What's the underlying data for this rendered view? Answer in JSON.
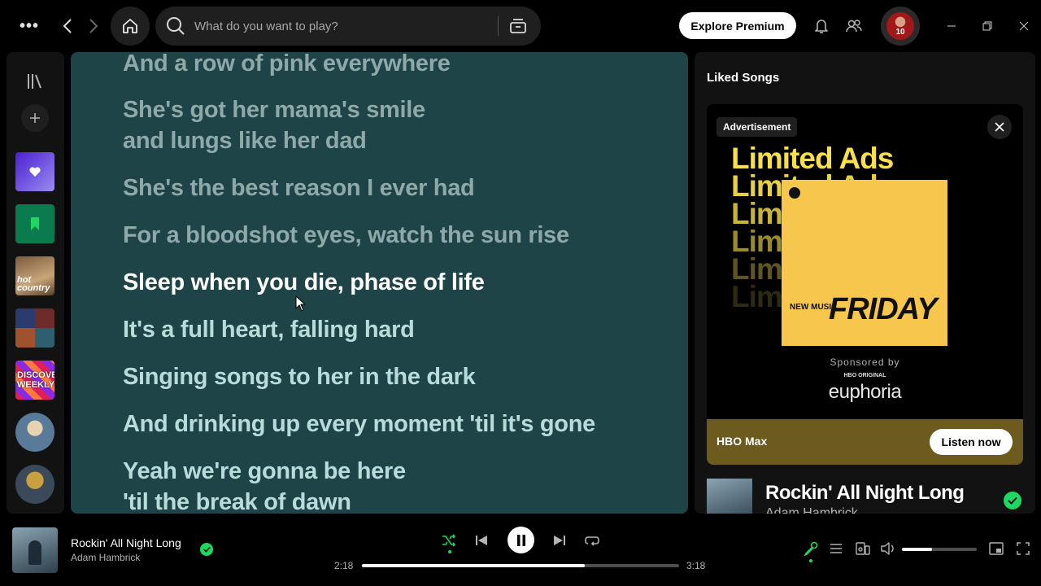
{
  "topbar": {
    "menu_icon": "more-dots-icon",
    "search_placeholder": "What do you want to play?",
    "premium_label": "Explore Premium",
    "avatar_label": "10"
  },
  "sidebar": {
    "items": [
      {
        "name": "Liked Songs"
      },
      {
        "name": "Your Episodes"
      },
      {
        "name": "Hot Country",
        "label": "hot country"
      },
      {
        "name": "Mix"
      },
      {
        "name": "Discover Weekly",
        "label": "DISCOVER WEEKLY"
      },
      {
        "name": "Artist 1"
      },
      {
        "name": "Artist 2"
      }
    ]
  },
  "lyrics": {
    "lines": [
      {
        "text": "And a row of pink everywhere",
        "state": "past"
      },
      {
        "text": "She's got her mama's smile",
        "state": "past"
      },
      {
        "text": "and lungs like her dad",
        "state": "past"
      },
      {
        "text": "She's the best reason I ever had",
        "state": "past"
      },
      {
        "text": "For a bloodshot eyes, watch the sun rise",
        "state": "past"
      },
      {
        "text": "Sleep when you die, phase of life",
        "state": "active"
      },
      {
        "text": "It's a full heart, falling hard",
        "state": "upcoming"
      },
      {
        "text": "Singing songs to her in the dark",
        "state": "upcoming"
      },
      {
        "text": "And drinking up every moment 'til it's gone",
        "state": "upcoming"
      },
      {
        "text": "Yeah we're gonna be here",
        "state": "upcoming"
      },
      {
        "text": "'til the break of dawn",
        "state": "upcoming"
      }
    ]
  },
  "right_panel": {
    "title": "Liked Songs",
    "ad": {
      "badge": "Advertisement",
      "headline": "Limited Ads",
      "cover_small": "NEW MUSIC",
      "cover_big": "FRIDAY",
      "sponsored_by": "Sponsored by",
      "sponsor_small": "HBO ORIGINAL",
      "sponsor_name": "euphoria",
      "advertiser": "HBO Max",
      "cta": "Listen now"
    },
    "now_playing": {
      "title": "Rockin' All Night Long",
      "artist": "Adam Hambrick"
    }
  },
  "player": {
    "title": "Rockin' All Night Long",
    "artist": "Adam Hambrick",
    "current_time": "2:18",
    "total_time": "3:18",
    "progress": 0.703,
    "volume": 0.4,
    "shuffle_on": true,
    "is_playing": true
  },
  "colors": {
    "accent": "#1ed760",
    "lyrics_bg": "#1e4447",
    "ad_yellow": "#f7c64c"
  }
}
